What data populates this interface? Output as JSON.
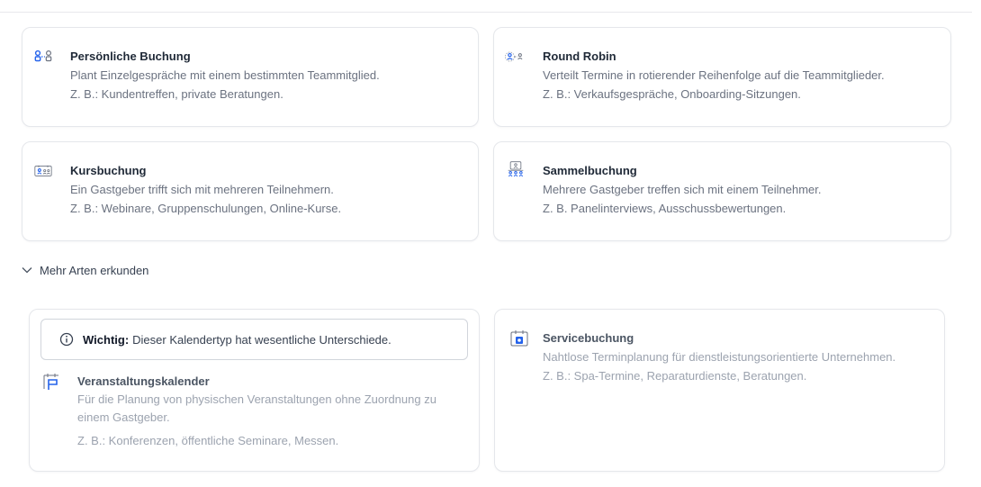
{
  "cards": [
    {
      "icon": "person-link-icon",
      "title": "Persönliche Buchung",
      "description": "Plant Einzelgespräche mit einem bestimmten Teammitglied.",
      "example": "Z. B.: Kundentreffen, private Beratungen."
    },
    {
      "icon": "round-robin-icon",
      "title": "Round Robin",
      "description": "Verteilt Termine in rotierender Reihenfolge auf die Teammitglieder.",
      "example": "Z. B.: Verkaufsgespräche, Onboarding-Sitzungen."
    },
    {
      "icon": "class-group-icon",
      "title": "Kursbuchung",
      "description": "Ein Gastgeber trifft sich mit mehreren Teilnehmern.",
      "example": "Z. B.: Webinare, Gruppenschulungen, Online-Kurse."
    },
    {
      "icon": "panel-group-icon",
      "title": "Sammelbuchung",
      "description": "Mehrere Gastgeber treffen sich mit einem Teilnehmer.",
      "example": "Z. B. Panelinterviews, Ausschussbewertungen."
    }
  ],
  "more_types": {
    "label": "Mehr Arten erkunden",
    "icon": "chevron-down-icon"
  },
  "event_card": {
    "notice_strong": "Wichtig:",
    "notice_text": "Dieser Kalendertyp hat wesentliche Unterschiede.",
    "icon": "event-calendar-icon",
    "title": "Veranstaltungskalender",
    "description": "Für die Planung von physischen Veranstaltungen ohne Zuordnung zu einem Gastgeber.",
    "example": "Z. B.: Konferenzen, öffentliche Seminare, Messen."
  },
  "service_card": {
    "icon": "service-calendar-icon",
    "title": "Servicebuchung",
    "description": "Nahtlose Terminplanung für dienstleistungsorientierte Unternehmen.",
    "example": "Z. B.: Spa-Termine, Reparaturdienste, Beratungen."
  },
  "colors": {
    "accent": "#2563eb",
    "text": "#1f2937",
    "muted": "#6b7280",
    "border": "#e5e7eb"
  }
}
